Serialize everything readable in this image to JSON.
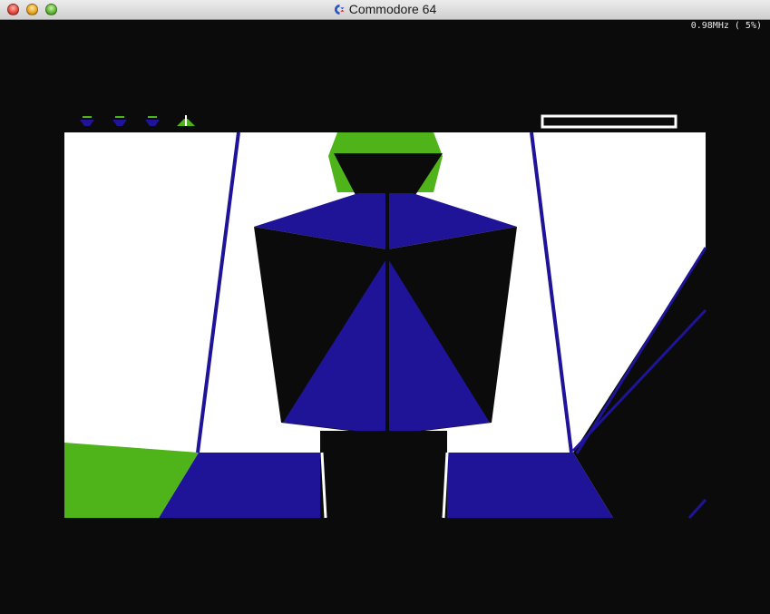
{
  "window": {
    "title": "Commodore 64",
    "speed": "0.98MHz ( 5%)",
    "icons": [
      "close-button",
      "minimize-button",
      "zoom-button",
      "commodore-logo-icon"
    ]
  },
  "game": {
    "lives_icons": [
      "ship-icon",
      "ship-icon",
      "ship-icon",
      "player-ship-icon"
    ],
    "energy_bar": {
      "fill": 0.0
    },
    "colors": {
      "background": "#0b0b0b",
      "white": "#ffffff",
      "blue": "#1f1497",
      "green": "#4fb31a",
      "black": "#0b0b0b"
    }
  }
}
